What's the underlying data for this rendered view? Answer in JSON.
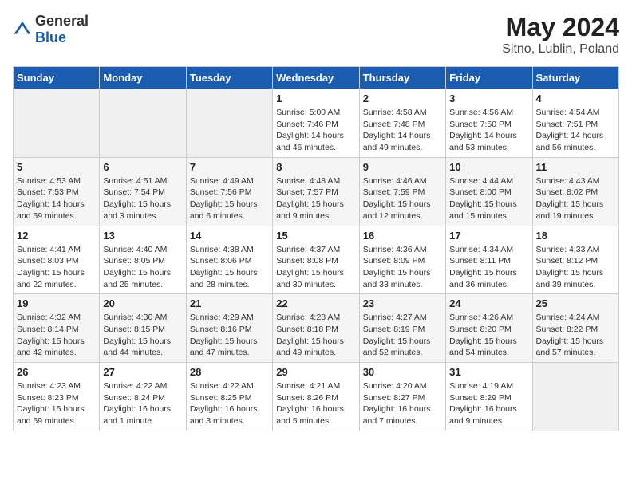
{
  "header": {
    "logo_general": "General",
    "logo_blue": "Blue",
    "month_year": "May 2024",
    "location": "Sitno, Lublin, Poland"
  },
  "weekdays": [
    "Sunday",
    "Monday",
    "Tuesday",
    "Wednesday",
    "Thursday",
    "Friday",
    "Saturday"
  ],
  "weeks": [
    [
      {
        "day": "",
        "sunrise": "",
        "sunset": "",
        "daylight": ""
      },
      {
        "day": "",
        "sunrise": "",
        "sunset": "",
        "daylight": ""
      },
      {
        "day": "",
        "sunrise": "",
        "sunset": "",
        "daylight": ""
      },
      {
        "day": "1",
        "sunrise": "Sunrise: 5:00 AM",
        "sunset": "Sunset: 7:46 PM",
        "daylight": "Daylight: 14 hours and 46 minutes."
      },
      {
        "day": "2",
        "sunrise": "Sunrise: 4:58 AM",
        "sunset": "Sunset: 7:48 PM",
        "daylight": "Daylight: 14 hours and 49 minutes."
      },
      {
        "day": "3",
        "sunrise": "Sunrise: 4:56 AM",
        "sunset": "Sunset: 7:50 PM",
        "daylight": "Daylight: 14 hours and 53 minutes."
      },
      {
        "day": "4",
        "sunrise": "Sunrise: 4:54 AM",
        "sunset": "Sunset: 7:51 PM",
        "daylight": "Daylight: 14 hours and 56 minutes."
      }
    ],
    [
      {
        "day": "5",
        "sunrise": "Sunrise: 4:53 AM",
        "sunset": "Sunset: 7:53 PM",
        "daylight": "Daylight: 14 hours and 59 minutes."
      },
      {
        "day": "6",
        "sunrise": "Sunrise: 4:51 AM",
        "sunset": "Sunset: 7:54 PM",
        "daylight": "Daylight: 15 hours and 3 minutes."
      },
      {
        "day": "7",
        "sunrise": "Sunrise: 4:49 AM",
        "sunset": "Sunset: 7:56 PM",
        "daylight": "Daylight: 15 hours and 6 minutes."
      },
      {
        "day": "8",
        "sunrise": "Sunrise: 4:48 AM",
        "sunset": "Sunset: 7:57 PM",
        "daylight": "Daylight: 15 hours and 9 minutes."
      },
      {
        "day": "9",
        "sunrise": "Sunrise: 4:46 AM",
        "sunset": "Sunset: 7:59 PM",
        "daylight": "Daylight: 15 hours and 12 minutes."
      },
      {
        "day": "10",
        "sunrise": "Sunrise: 4:44 AM",
        "sunset": "Sunset: 8:00 PM",
        "daylight": "Daylight: 15 hours and 15 minutes."
      },
      {
        "day": "11",
        "sunrise": "Sunrise: 4:43 AM",
        "sunset": "Sunset: 8:02 PM",
        "daylight": "Daylight: 15 hours and 19 minutes."
      }
    ],
    [
      {
        "day": "12",
        "sunrise": "Sunrise: 4:41 AM",
        "sunset": "Sunset: 8:03 PM",
        "daylight": "Daylight: 15 hours and 22 minutes."
      },
      {
        "day": "13",
        "sunrise": "Sunrise: 4:40 AM",
        "sunset": "Sunset: 8:05 PM",
        "daylight": "Daylight: 15 hours and 25 minutes."
      },
      {
        "day": "14",
        "sunrise": "Sunrise: 4:38 AM",
        "sunset": "Sunset: 8:06 PM",
        "daylight": "Daylight: 15 hours and 28 minutes."
      },
      {
        "day": "15",
        "sunrise": "Sunrise: 4:37 AM",
        "sunset": "Sunset: 8:08 PM",
        "daylight": "Daylight: 15 hours and 30 minutes."
      },
      {
        "day": "16",
        "sunrise": "Sunrise: 4:36 AM",
        "sunset": "Sunset: 8:09 PM",
        "daylight": "Daylight: 15 hours and 33 minutes."
      },
      {
        "day": "17",
        "sunrise": "Sunrise: 4:34 AM",
        "sunset": "Sunset: 8:11 PM",
        "daylight": "Daylight: 15 hours and 36 minutes."
      },
      {
        "day": "18",
        "sunrise": "Sunrise: 4:33 AM",
        "sunset": "Sunset: 8:12 PM",
        "daylight": "Daylight: 15 hours and 39 minutes."
      }
    ],
    [
      {
        "day": "19",
        "sunrise": "Sunrise: 4:32 AM",
        "sunset": "Sunset: 8:14 PM",
        "daylight": "Daylight: 15 hours and 42 minutes."
      },
      {
        "day": "20",
        "sunrise": "Sunrise: 4:30 AM",
        "sunset": "Sunset: 8:15 PM",
        "daylight": "Daylight: 15 hours and 44 minutes."
      },
      {
        "day": "21",
        "sunrise": "Sunrise: 4:29 AM",
        "sunset": "Sunset: 8:16 PM",
        "daylight": "Daylight: 15 hours and 47 minutes."
      },
      {
        "day": "22",
        "sunrise": "Sunrise: 4:28 AM",
        "sunset": "Sunset: 8:18 PM",
        "daylight": "Daylight: 15 hours and 49 minutes."
      },
      {
        "day": "23",
        "sunrise": "Sunrise: 4:27 AM",
        "sunset": "Sunset: 8:19 PM",
        "daylight": "Daylight: 15 hours and 52 minutes."
      },
      {
        "day": "24",
        "sunrise": "Sunrise: 4:26 AM",
        "sunset": "Sunset: 8:20 PM",
        "daylight": "Daylight: 15 hours and 54 minutes."
      },
      {
        "day": "25",
        "sunrise": "Sunrise: 4:24 AM",
        "sunset": "Sunset: 8:22 PM",
        "daylight": "Daylight: 15 hours and 57 minutes."
      }
    ],
    [
      {
        "day": "26",
        "sunrise": "Sunrise: 4:23 AM",
        "sunset": "Sunset: 8:23 PM",
        "daylight": "Daylight: 15 hours and 59 minutes."
      },
      {
        "day": "27",
        "sunrise": "Sunrise: 4:22 AM",
        "sunset": "Sunset: 8:24 PM",
        "daylight": "Daylight: 16 hours and 1 minute."
      },
      {
        "day": "28",
        "sunrise": "Sunrise: 4:22 AM",
        "sunset": "Sunset: 8:25 PM",
        "daylight": "Daylight: 16 hours and 3 minutes."
      },
      {
        "day": "29",
        "sunrise": "Sunrise: 4:21 AM",
        "sunset": "Sunset: 8:26 PM",
        "daylight": "Daylight: 16 hours and 5 minutes."
      },
      {
        "day": "30",
        "sunrise": "Sunrise: 4:20 AM",
        "sunset": "Sunset: 8:27 PM",
        "daylight": "Daylight: 16 hours and 7 minutes."
      },
      {
        "day": "31",
        "sunrise": "Sunrise: 4:19 AM",
        "sunset": "Sunset: 8:29 PM",
        "daylight": "Daylight: 16 hours and 9 minutes."
      },
      {
        "day": "",
        "sunrise": "",
        "sunset": "",
        "daylight": ""
      }
    ]
  ]
}
